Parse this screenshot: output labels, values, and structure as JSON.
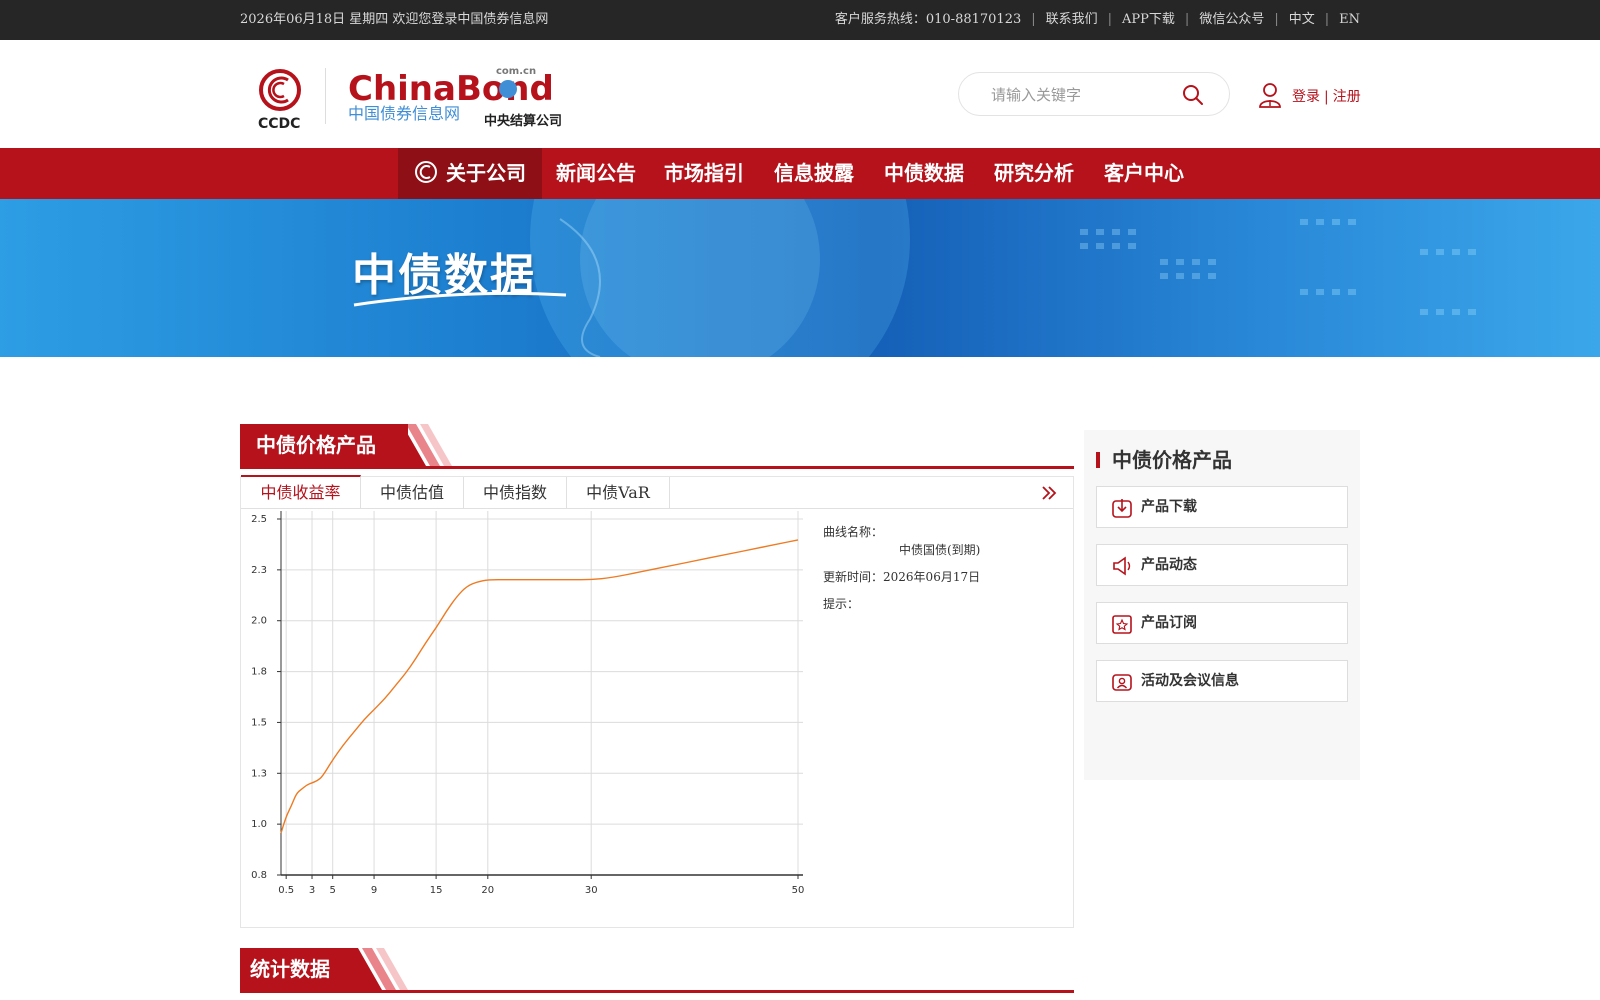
{
  "topbar": {
    "welcome": "2026年06月18日 星期四 欢迎您登录中国债券信息网",
    "hotline": "客户服务热线：010-88170123",
    "links": [
      "联系我们",
      "APP下载",
      "微信公众号",
      "中文",
      "EN"
    ]
  },
  "header": {
    "logo_ccdc": "CCDC",
    "logo_cn": "中国债券信息网",
    "logo_comcn": "com.cn",
    "logo_sub": "中央结算公司",
    "logo_brand": "ChinaBond",
    "search_placeholder": "请输入关键字",
    "login": "登录",
    "register": "注册",
    "login_sep": "|"
  },
  "nav": {
    "items": [
      "关于公司",
      "新闻公告",
      "市场指引",
      "信息披露",
      "中债数据",
      "研究分析",
      "客户中心"
    ]
  },
  "banner": {
    "title": "中债数据"
  },
  "main": {
    "section_title": "中债价格产品",
    "tabs": [
      "中债收益率",
      "中债估值",
      "中债指数",
      "中债VaR"
    ],
    "info": {
      "curve_label": "曲线名称：",
      "curve_name": "中债国债(到期)",
      "update_label": "更新时间：",
      "update_date": "2026年06月17日",
      "tip_label": "提示："
    },
    "stats_title": "统计数据"
  },
  "sidebar": {
    "title": "中债价格产品",
    "items": [
      "产品下载",
      "产品动态",
      "产品订阅",
      "活动及会议信息"
    ]
  },
  "chart_data": {
    "type": "line",
    "x_ticks": [
      "0.5",
      "3",
      "5",
      "9",
      "15",
      "20",
      "30",
      "50"
    ],
    "y_ticks": [
      "0.8",
      "1.0",
      "1.3",
      "1.5",
      "1.8",
      "2.0",
      "2.3",
      "2.5"
    ],
    "x_tick_values": [
      0.5,
      3,
      5,
      9,
      15,
      20,
      30,
      50
    ],
    "xlim": [
      0,
      50
    ],
    "ylim": [
      0.8,
      2.5
    ],
    "grid": true,
    "color": "#ee7a22",
    "x": [
      0,
      0.5,
      1,
      1.5,
      2,
      2.5,
      3,
      3.5,
      4,
      5,
      6,
      7,
      8,
      9,
      10,
      11,
      12,
      13,
      14,
      15,
      16,
      17,
      18,
      19,
      20,
      22,
      25,
      28,
      30,
      32,
      35,
      38,
      40,
      43,
      46,
      48,
      50
    ],
    "y": [
      1.0,
      1.08,
      1.13,
      1.19,
      1.21,
      1.23,
      1.24,
      1.25,
      1.27,
      1.35,
      1.42,
      1.48,
      1.54,
      1.59,
      1.64,
      1.7,
      1.76,
      1.83,
      1.91,
      1.98,
      2.06,
      2.13,
      2.18,
      2.2,
      2.21,
      2.21,
      2.21,
      2.21,
      2.21,
      2.22,
      2.25,
      2.28,
      2.3,
      2.33,
      2.36,
      2.38,
      2.4
    ]
  }
}
